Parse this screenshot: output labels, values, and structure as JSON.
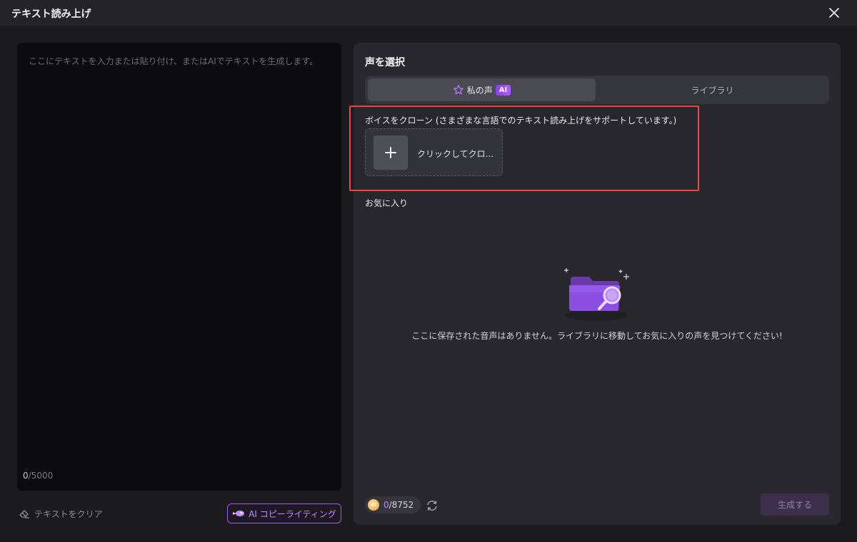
{
  "window": {
    "title": "テキスト読み上げ",
    "close_icon": "close-icon"
  },
  "editor": {
    "placeholder": "ここにテキストを入力または貼り付け、またはAIでテキストを生成します。",
    "count_current": "0",
    "count_max": "/5000",
    "clear_label": "テキストをクリア",
    "ai_copy_label": "AI コピーライティング"
  },
  "voice_panel": {
    "title": "声を選択",
    "tabs": [
      {
        "label": "私の声",
        "badge": "AI",
        "icon": "star-icon",
        "active": true
      },
      {
        "label": "ライブラリ",
        "active": false
      }
    ],
    "clone_label": "ボイスをクローン (さまざまな言語でのテキスト読み上げをサポートしています。)",
    "clone_button_label": "クリックしてクロ...",
    "favorites_label": "お気に入り",
    "empty_message": "ここに保存された音声はありません。ライブラリに移動してお気に入りの声を見つけてください!",
    "credits_icon_label": "AI",
    "credits_used": "0",
    "credits_total": "/8752",
    "generate_label": "生成する"
  },
  "colors": {
    "accent": "#a155f0",
    "highlight_border": "#e84a3f",
    "background": "#1b1b1f",
    "panel": "#27272d"
  }
}
